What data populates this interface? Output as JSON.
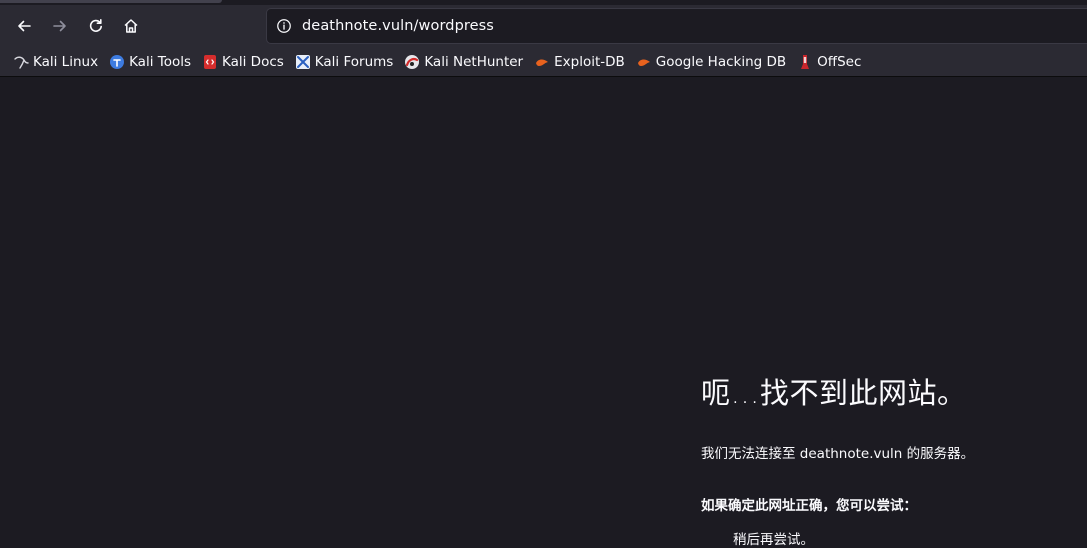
{
  "browser": {
    "url": "deathnote.vuln/wordpress",
    "nav": {
      "back_icon": "arrow-left-icon",
      "forward_icon": "arrow-right-icon",
      "reload_icon": "reload-icon",
      "home_icon": "home-icon"
    }
  },
  "bookmarks": [
    {
      "label": "Kali Linux",
      "icon": "kali-dragon-icon"
    },
    {
      "label": "Kali Tools",
      "icon": "kali-tools-icon"
    },
    {
      "label": "Kali Docs",
      "icon": "kali-docs-icon"
    },
    {
      "label": "Kali Forums",
      "icon": "kali-forums-icon"
    },
    {
      "label": "Kali NetHunter",
      "icon": "kali-nethunter-icon"
    },
    {
      "label": "Exploit-DB",
      "icon": "exploit-db-icon"
    },
    {
      "label": "Google Hacking DB",
      "icon": "ghdb-icon"
    },
    {
      "label": "OffSec",
      "icon": "offsec-icon"
    }
  ],
  "error": {
    "title": "呃…找不到此网站。",
    "message": "我们无法连接至 deathnote.vuln 的服务器。",
    "hint": "如果确定此网址正确，您可以尝试：",
    "suggestion": "稍后再尝试。"
  },
  "colors": {
    "chrome": "#2b2a33",
    "page_bg": "#1c1b22",
    "text": "#fbfbfe"
  }
}
